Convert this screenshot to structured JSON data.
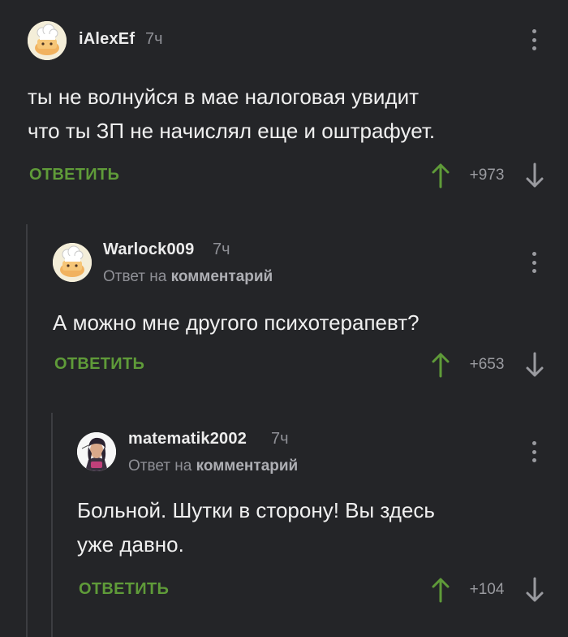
{
  "colors": {
    "background": "#242528",
    "accent_reply": "#5f9b39",
    "upvote": "#5f9b39",
    "muted": "#8f9096"
  },
  "comments": [
    {
      "author": "iAlexEf",
      "time": "7ч",
      "reply_prefix": "",
      "reply_target": "",
      "text_lines": [
        "ты не волнуйся в мае налоговая увидит",
        "что ты ЗП не начислял еще и оштрафует."
      ],
      "reply_label": "ОТВЕТИТЬ",
      "rating": "+973",
      "avatar": "cook-hat-avatar"
    },
    {
      "author": "Warlock009",
      "time": "7ч",
      "reply_prefix": "Ответ на",
      "reply_target": "комментарий",
      "text_lines": [
        "А можно мне другого психотерапевт?"
      ],
      "reply_label": "ОТВЕТИТЬ",
      "rating": "+653",
      "avatar": "cook-hat-avatar"
    },
    {
      "author": "matematik2002",
      "time": "7ч",
      "reply_prefix": "Ответ на",
      "reply_target": "комментарий",
      "text_lines": [
        "Больной. Шутки в сторону! Вы здесь",
        "уже давно."
      ],
      "reply_label": "ОТВЕТИТЬ",
      "rating": "+104",
      "avatar": "user-photo-avatar"
    }
  ]
}
